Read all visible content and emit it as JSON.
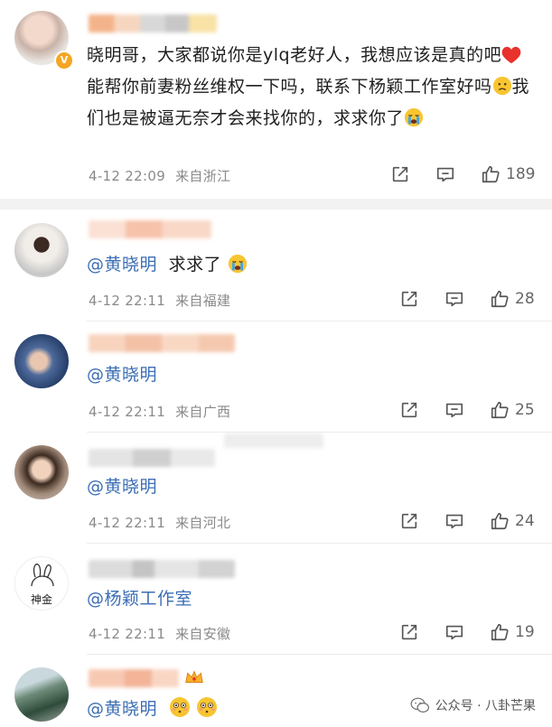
{
  "comments": [
    {
      "text_prefix": "晓明哥，大家都说你是ylq老好人，我想应该是真的吧",
      "text_mid": "能帮你前妻粉丝维权一下吗，联系下杨颖工作室好吗",
      "text_mid2": "我们也是被逼无奈才会来找你的，求求你了",
      "time": "4-12 22:09",
      "location": "来自浙江",
      "likes": "189",
      "verified_badge": "V"
    },
    {
      "mention": "@黄晓明",
      "text": "求求了",
      "time": "4-12 22:11",
      "location": "来自福建",
      "likes": "28"
    },
    {
      "mention": "@黄晓明",
      "time": "4-12 22:11",
      "location": "来自广西",
      "likes": "25"
    },
    {
      "mention": "@黄晓明",
      "time": "4-12 22:11",
      "location": "来自河北",
      "likes": "24"
    },
    {
      "mention": "@杨颖工作室",
      "avatar_text": "神金",
      "time": "4-12 22:11",
      "location": "来自安徽",
      "likes": "19"
    },
    {
      "mention": "@黄晓明"
    }
  ],
  "watermark": "公众号 · 八卦芒果",
  "icons": [
    "share-icon",
    "comment-icon",
    "like-icon",
    "heart-icon",
    "crying-emoji",
    "worried-emoji",
    "flushed-emoji",
    "crown-icon",
    "wechat-icon"
  ]
}
